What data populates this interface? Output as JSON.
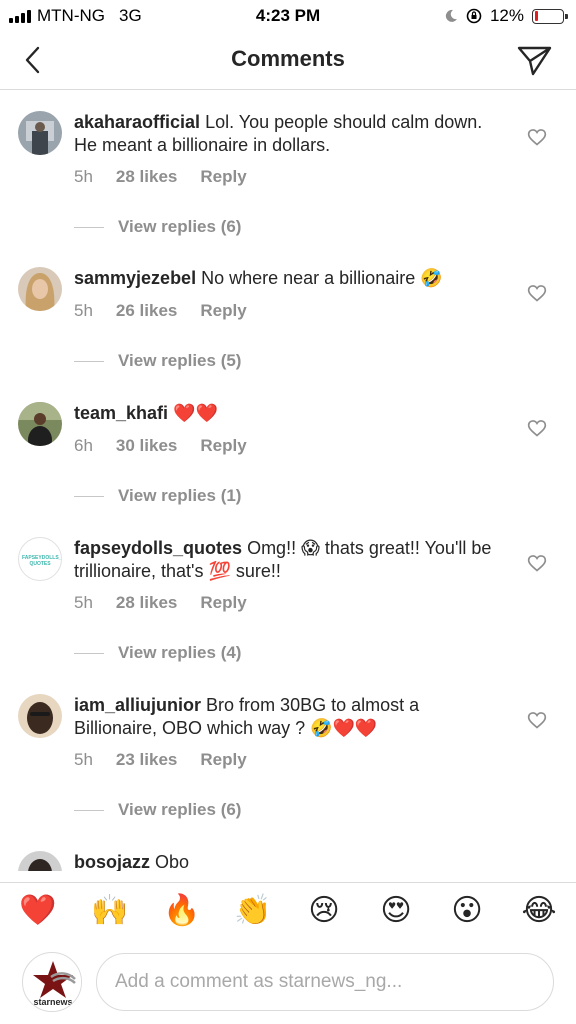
{
  "status_bar": {
    "carrier": "MTN-NG",
    "network": "3G",
    "time": "4:23 PM",
    "battery": "12%",
    "battery_level": 0.12,
    "icons": [
      "signal-icon",
      "moon-icon",
      "orientation-lock-icon",
      "battery-icon"
    ]
  },
  "header": {
    "title": "Comments",
    "back_icon": "chevron-left-icon",
    "direct_icon": "paper-plane-icon"
  },
  "comments": [
    {
      "username": "akaharaofficial",
      "text": "Lol. You people should calm down.  He meant a billionaire in dollars.",
      "time": "5h",
      "likes": "28 likes",
      "reply": "Reply",
      "view_replies": "View replies (6)"
    },
    {
      "username": "sammyjezebel",
      "text": "No where near a billionaire 🤣",
      "time": "5h",
      "likes": "26 likes",
      "reply": "Reply",
      "view_replies": "View replies (5)"
    },
    {
      "username": "team_khafi",
      "text": "❤️❤️",
      "time": "6h",
      "likes": "30 likes",
      "reply": "Reply",
      "view_replies": "View replies (1)"
    },
    {
      "username": "fapseydolls_quotes",
      "text": "Omg!! 😱 thats great!! You'll be trillionaire,  that's 💯 sure!!",
      "time": "5h",
      "likes": "28 likes",
      "reply": "Reply",
      "view_replies": "View replies (4)",
      "avatar_text": "FAPSEYDOLLS_ QUOTES"
    },
    {
      "username": "iam_alliujunior",
      "text": "Bro from 30BG to almost a Billionaire, OBO which way ? 🤣❤️❤️",
      "time": "5h",
      "likes": "23 likes",
      "reply": "Reply",
      "view_replies": "View replies (6)"
    },
    {
      "username": "bosojazz",
      "text": "Obo"
    }
  ],
  "emoji_bar": [
    "❤️",
    "🙌",
    "🔥",
    "👏",
    "😢",
    "😍",
    "😮",
    "😂"
  ],
  "composer": {
    "placeholder": "Add a comment as starnews_ng...",
    "avatar_label": "starnews"
  }
}
